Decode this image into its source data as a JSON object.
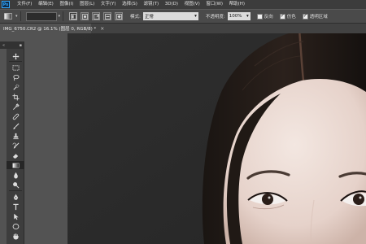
{
  "app": {
    "logo_text": "Ps"
  },
  "menu": {
    "items": [
      "文件(F)",
      "编辑(E)",
      "图像(I)",
      "图层(L)",
      "文字(Y)",
      "选择(S)",
      "滤镜(T)",
      "3D(D)",
      "视图(V)",
      "窗口(W)",
      "帮助(H)"
    ]
  },
  "options": {
    "mode_label": "模式:",
    "mode_value": "正常",
    "opacity_label": "不透明度:",
    "opacity_value": "100%",
    "reverse_label": "反向",
    "dither_label": "仿色",
    "transparency_label": "透明区域",
    "reverse_checked": false,
    "dither_checked": true,
    "transparency_checked": true
  },
  "document": {
    "tab_title": "IMG_6750.CR2 @ 16.1% (图层 0, RGB/8) *",
    "close_glyph": "×"
  },
  "toolbox": {
    "collapse_glyph": "«",
    "tools": [
      "move-tool",
      "marquee-tool",
      "lasso-tool",
      "quick-select-tool",
      "crop-tool",
      "eyedropper-tool",
      "healing-brush-tool",
      "brush-tool",
      "clone-stamp-tool",
      "history-brush-tool",
      "eraser-tool",
      "gradient-tool",
      "blur-tool",
      "dodge-tool",
      "pen-tool",
      "type-tool",
      "path-select-tool",
      "shape-tool",
      "hand-tool",
      "zoom-tool"
    ],
    "active_tool": "gradient-tool"
  },
  "colors": {
    "menubar_bg": "#3c3c3c",
    "panel_bg": "#535353",
    "canvas_bg": "#2b2b2b",
    "brand_blue": "#31a8ff"
  }
}
